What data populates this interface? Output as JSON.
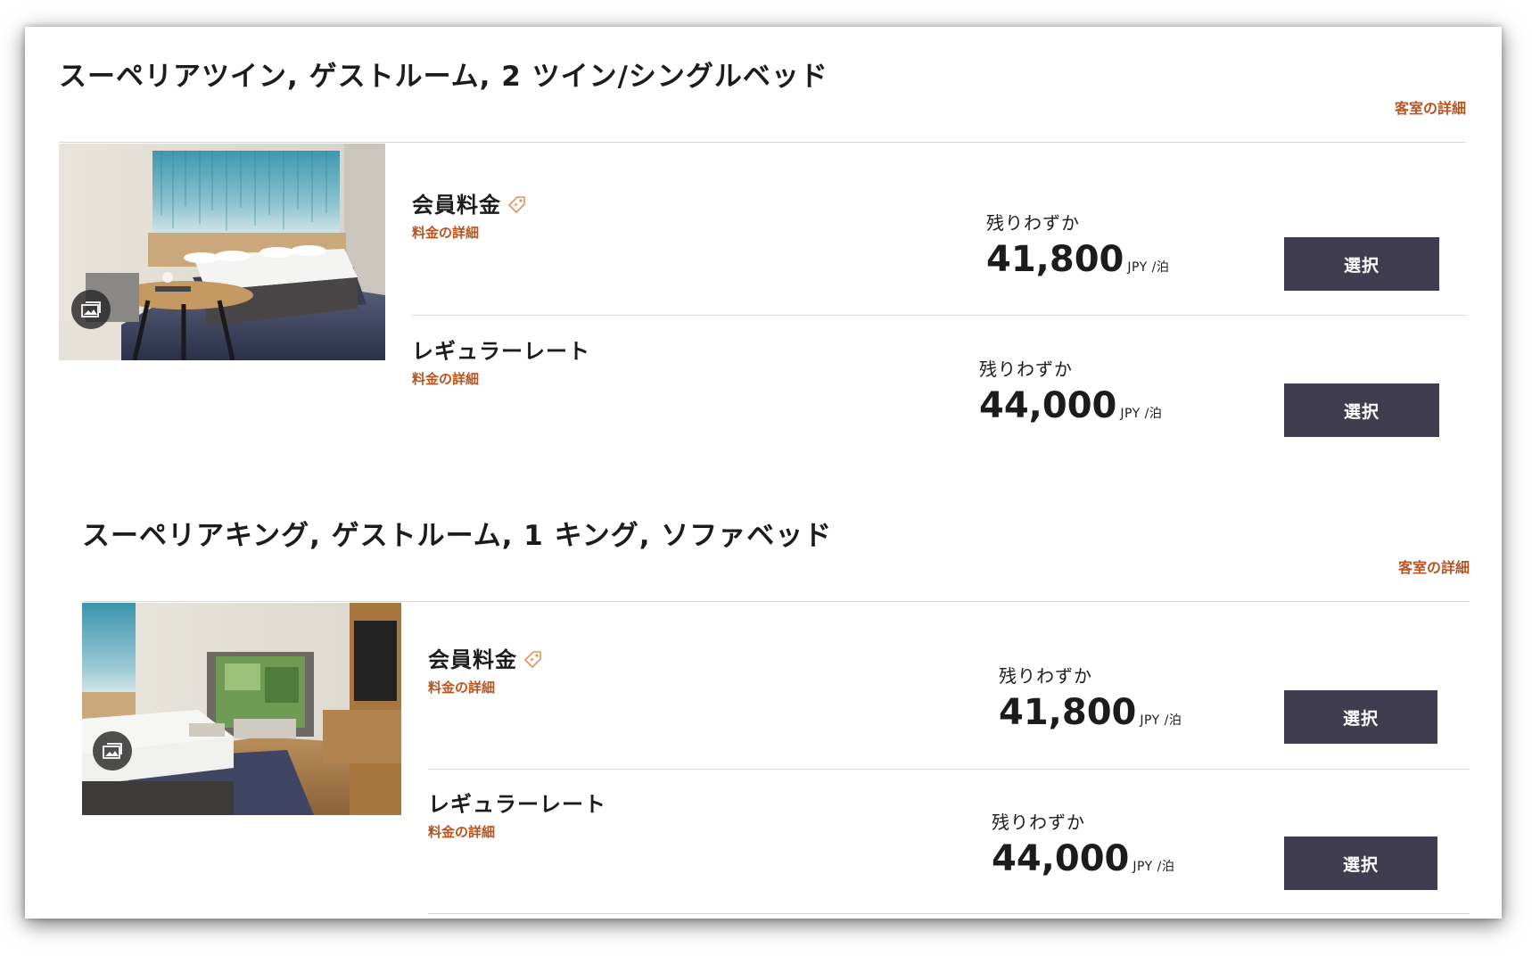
{
  "rooms": [
    {
      "title": "スーペリアツイン, ゲストルーム, 2 ツイン/シングルベッド",
      "detail_link": "客室の詳細",
      "photo_icon": "image-gallery-icon",
      "rates": [
        {
          "name": "会員料金",
          "has_member_tag": true,
          "tag_icon": "member-tag-icon",
          "detail_link": "料金の詳細",
          "availability": "残りわずか",
          "price": "41,800",
          "unit": "JPY /泊",
          "select_label": "選択"
        },
        {
          "name": "レギュラーレート",
          "has_member_tag": false,
          "detail_link": "料金の詳細",
          "availability": "残りわずか",
          "price": "44,000",
          "unit": "JPY /泊",
          "select_label": "選択"
        }
      ]
    },
    {
      "title": "スーペリアキング, ゲストルーム, 1 キング, ソファベッド",
      "detail_link": "客室の詳細",
      "photo_icon": "image-gallery-icon",
      "rates": [
        {
          "name": "会員料金",
          "has_member_tag": true,
          "tag_icon": "member-tag-icon",
          "detail_link": "料金の詳細",
          "availability": "残りわずか",
          "price": "41,800",
          "unit": "JPY /泊",
          "select_label": "選択"
        },
        {
          "name": "レギュラーレート",
          "has_member_tag": false,
          "detail_link": "料金の詳細",
          "availability": "残りわずか",
          "price": "44,000",
          "unit": "JPY /泊",
          "select_label": "選択"
        }
      ]
    }
  ],
  "colors": {
    "accent": "#b9541f",
    "button": "#403d51",
    "divider": "#d6d6d6"
  }
}
